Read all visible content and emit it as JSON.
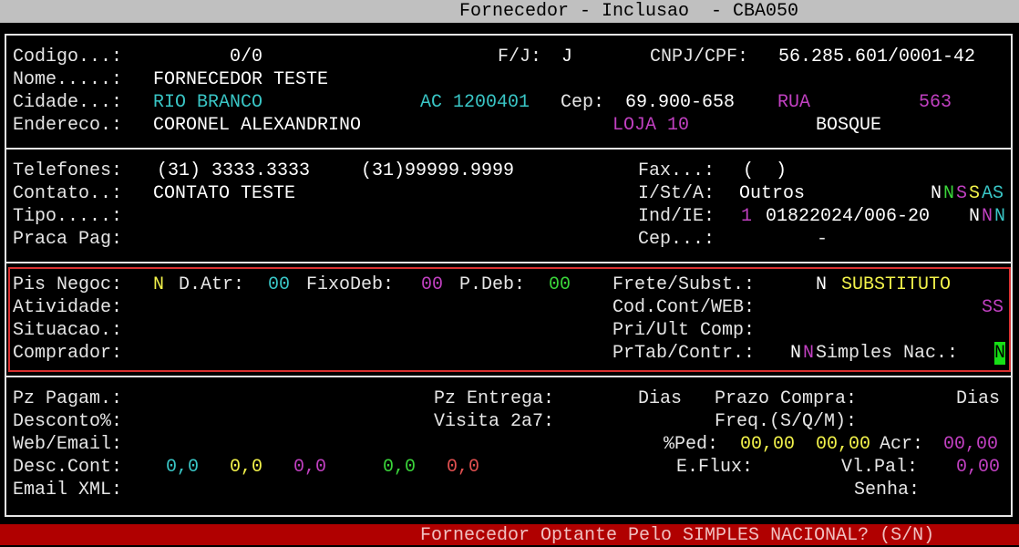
{
  "window": {
    "title": "Fornecedor - Inclusao  - CBA050"
  },
  "section1": {
    "codigo_label": "Codigo...:",
    "codigo_value": "0/0",
    "fj_label": "F/J:",
    "fj_value": "J",
    "cnpj_label": "CNPJ/CPF:",
    "cnpj_value": "56.285.601/0001-42",
    "nome_label": "Nome.....:",
    "nome_value": "FORNECEDOR TESTE",
    "cidade_label": "Cidade...:",
    "cidade_value": "RIO BRANCO",
    "uf_code": "AC 1200401",
    "cep_label": "Cep:",
    "cep_value": "69.900-658",
    "rua_value": "RUA",
    "numero_value": "563",
    "endereco_label": "Endereco.:",
    "endereco_value": "CORONEL ALEXANDRINO",
    "complemento_value": "LOJA 10",
    "bairro_value": "BOSQUE"
  },
  "section2": {
    "telefones_label": "Telefones:",
    "telefone1": "(31) 3333.3333",
    "telefone2": "(31)99999.9999",
    "fax_label": "Fax...:",
    "fax_value": "(  )",
    "contato_label": "Contato..:",
    "contato_value": "CONTATO TESTE",
    "ista_label": "I/St/A:",
    "ista_value": "Outros",
    "flags_a1": "N",
    "flags_a2": "N",
    "flags_a3": "S",
    "flags_a4": "S",
    "flags_a5": "AS",
    "tipo_label": "Tipo.....:",
    "indie_label": "Ind/IE:",
    "indie_ind": "1",
    "indie_value": "01822024/006-20",
    "indie_f1": "N",
    "indie_f2": "N",
    "indie_f3": "N",
    "praca_label": "Praca Pag:",
    "cep2_label": "Cep...:",
    "cep2_value": "-"
  },
  "section3": {
    "pis_label": "Pis Negoc:",
    "pis_value": "N",
    "datr_label": "D.Atr:",
    "datr_value": "00",
    "fixodeb_label": "FixoDeb:",
    "fixodeb_value": "00",
    "pdeb_label": "P.Deb:",
    "pdeb_value": "00",
    "frete_label": "Frete/Subst.:",
    "frete_value": "N",
    "subst_value": "SUBSTITUTO",
    "atividade_label": "Atividade:",
    "codcont_label": "Cod.Cont/WEB:",
    "codcont_value": "SS",
    "situacao_label": "Situacao.:",
    "priult_label": "Pri/Ult Comp:",
    "comprador_label": "Comprador:",
    "prtab_label": "PrTab/Contr.:",
    "prtab_v1": "N",
    "prtab_v2": "N",
    "simples_label": "Simples Nac.:",
    "simples_value": "N"
  },
  "section4": {
    "pzpagam_label": "Pz Pagam.:",
    "pzentrega_label": "Pz Entrega:",
    "dias1": "Dias",
    "prazocompra_label": "Prazo Compra:",
    "dias2": "Dias",
    "desconto_label": "Desconto%:",
    "visita_label": "Visita 2a7:",
    "freq_label": "Freq.(S/Q/M):",
    "webemail_label": "Web/Email:",
    "ped_label": "%Ped:",
    "ped_value1": "00,00",
    "ped_value2": "00,00",
    "acr_label": "Acr:",
    "acr_value": "00,00",
    "desccont_label": "Desc.Cont:",
    "dc1": "0,0",
    "dc2": "0,0",
    "dc3": "0,0",
    "dc4": "0,0",
    "dc5": "0,0",
    "eflux_label": "E.Flux:",
    "vlpal_label": "Vl.Pal:",
    "vlpal_value": "0,00",
    "emailxml_label": "Email XML:",
    "senha_label": "Senha:"
  },
  "status": {
    "prompt": "Fornecedor Optante Pelo SIMPLES NACIONAL? (S/N)"
  }
}
